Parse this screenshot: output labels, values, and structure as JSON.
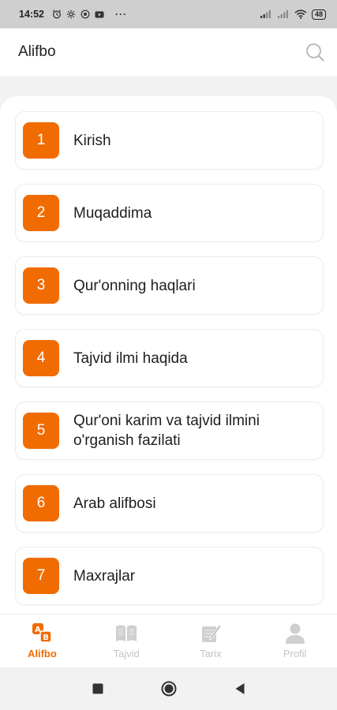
{
  "status_bar": {
    "time": "14:52",
    "battery": "48",
    "more": "···"
  },
  "header": {
    "title": "Alifbo"
  },
  "lessons": [
    {
      "number": "1",
      "title": "Kirish"
    },
    {
      "number": "2",
      "title": "Muqaddima"
    },
    {
      "number": "3",
      "title": "Qur'onning haqlari"
    },
    {
      "number": "4",
      "title": "Tajvid ilmi haqida"
    },
    {
      "number": "5",
      "title": "Qur'oni karim va tajvid ilmini o'rganish fazilati"
    },
    {
      "number": "6",
      "title": "Arab alifbosi"
    },
    {
      "number": "7",
      "title": "Maxrajlar"
    }
  ],
  "bottom_nav": [
    {
      "label": "Alifbo",
      "icon": "alphabet-icon",
      "active": true
    },
    {
      "label": "Tajvid",
      "icon": "book-icon",
      "active": false
    },
    {
      "label": "Tarix",
      "icon": "history-icon",
      "active": false
    },
    {
      "label": "Profil",
      "icon": "user-icon",
      "active": false
    }
  ],
  "colors": {
    "accent": "#f06c00",
    "inactive": "#c4c4c4"
  }
}
